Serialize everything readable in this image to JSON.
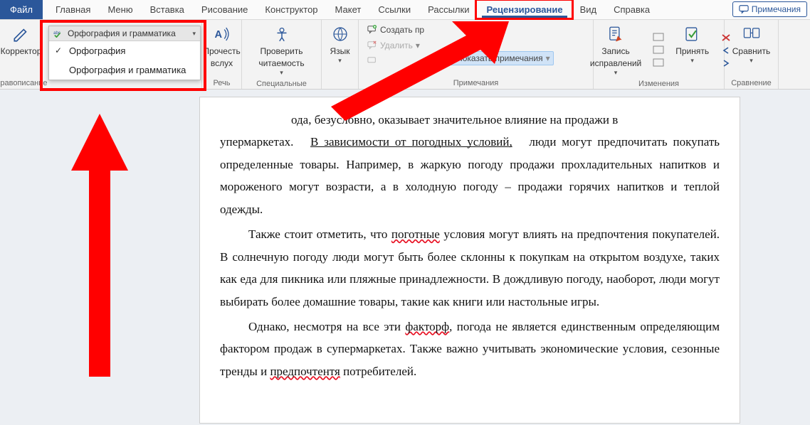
{
  "tabs": {
    "file": "Файл",
    "items": [
      "Главная",
      "Меню",
      "Вставка",
      "Рисование",
      "Конструктор",
      "Макет",
      "Ссылки",
      "Рассылки",
      "Рецензирование",
      "Вид",
      "Справка"
    ],
    "active_index": 8
  },
  "comments_btn": "Примечания",
  "ribbon": {
    "group_spelling": {
      "editor": "Корректор",
      "dropdown_header": "Орфография и грамматика",
      "dropdown_items": [
        "Орфография",
        "Орфография и грамматика"
      ],
      "label": "Правописание"
    },
    "group_speech": {
      "btn1a": "Прочесть",
      "btn1b": "вслух",
      "label": "Речь"
    },
    "group_access": {
      "btn1a": "Проверить",
      "btn1b": "читаемость",
      "label": "Специальные возм"
    },
    "group_lang": {
      "btn1": "Язык",
      "label": ""
    },
    "group_comments": {
      "new": "Создать пр",
      "delete": "Удалить",
      "prev": "",
      "next": "ледующее",
      "show": "Показать примечания",
      "label": "Примечания"
    },
    "group_changes": {
      "track1": "Запись",
      "track2": "исправлений",
      "accept": "Принять",
      "label": "Изменения"
    },
    "group_compare": {
      "btn": "Сравнить",
      "label": "Сравнение"
    }
  },
  "document": {
    "p1_a": "ода, безусловно, оказывает значительное влияние на продажи в",
    "p1_b1": "упермаркетах.",
    "p1_b_link": "В зависимости от погодных условий,",
    "p1_b2": "люди могут предпочитать покупать определенные товары. Например, в жаркую погоду продажи прохладительных напитков и мороженого могут возрасти, а в холодную погоду – продажи горячих напитков и теплой одежды.",
    "p2_a": "Также стоит отметить, что",
    "p2_err1": "поготные",
    "p2_b": "условия могут влиять на предпочтения покупателей. В солнечную погоду люди могут быть",
    "p2_b2": "более склонны к покупкам на открытом воздухе, таких как еда для пикника или пляжные принадлежности. В дождливую погоду, наоборот, люди могут выбирать более домашние товары, такие как книги или настольные игры.",
    "p3_a": "Однако, несмотря на все эти",
    "p3_err1": "факторф",
    "p3_b": ", погода не является единственным определяющим фактором продаж в супермаркетах. Также важно учитывать экономические условия, сезонные тренды и",
    "p3_err2": "предпочтентя",
    "p3_c": "потребителей."
  }
}
